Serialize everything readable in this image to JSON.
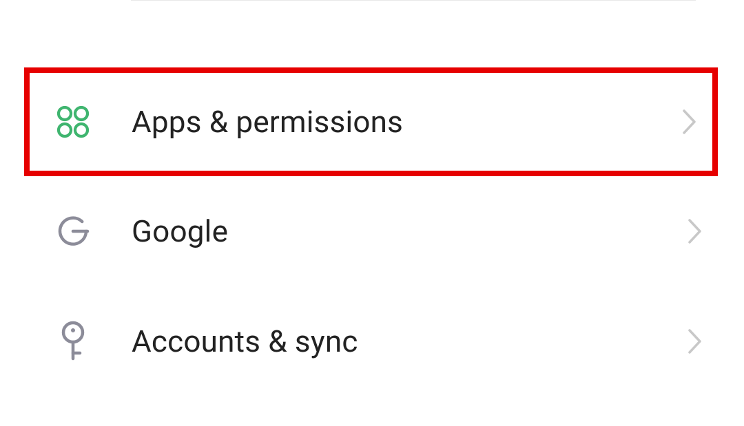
{
  "settings": {
    "items": [
      {
        "label": "Apps & permissions",
        "highlighted": true
      },
      {
        "label": "Google",
        "highlighted": false
      },
      {
        "label": "Accounts & sync",
        "highlighted": false
      }
    ]
  },
  "colors": {
    "highlight_border": "#e60000",
    "apps_icon": "#3fb56f",
    "neutral_icon": "#8c8c99",
    "chevron": "#c8c8c8",
    "text": "#222222"
  }
}
